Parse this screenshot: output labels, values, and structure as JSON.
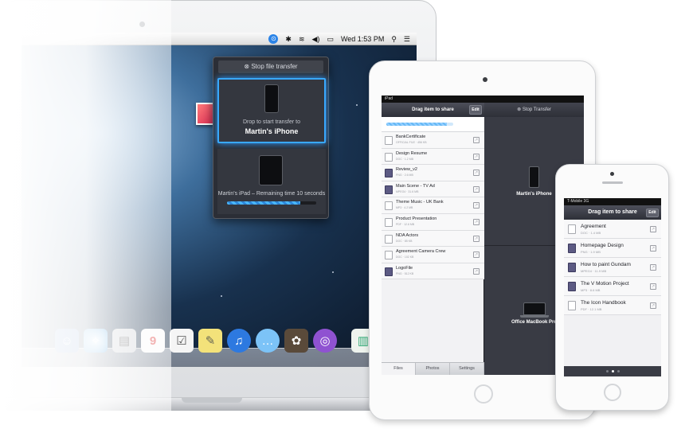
{
  "mac": {
    "menubar": {
      "clock": "Wed 1:53 PM",
      "icons": [
        "app-icon",
        "bluetooth-icon",
        "wifi-icon",
        "volume-icon",
        "battery-icon",
        "spotlight-icon",
        "notification-center-icon"
      ]
    },
    "popover": {
      "stop_label": "Stop file transfer",
      "drop_hint": "Drop to start transfer to",
      "target_device": "Martin's iPhone",
      "secondary_status": "Martin's iPad – Remaining time 10 seconds",
      "progress": 0.82
    },
    "dock": {
      "icons": [
        "finder-icon",
        "safari-icon",
        "preview-icon",
        "calendar-icon",
        "reminders-icon",
        "notes-icon",
        "app-store-icon",
        "messages-icon",
        "iphoto-icon",
        "instashare-icon",
        "file-icon",
        "trash-icon"
      ],
      "calendar_day": "9"
    }
  },
  "ipad": {
    "status": "iPad",
    "header": "Drag item to share",
    "edit_label": "Edit",
    "stop_label": "Stop Transfer",
    "progress": 0.9,
    "files": [
      {
        "name": "BankCertificate",
        "sub": "OFFICIAL FILE · 456 KB"
      },
      {
        "name": "Design Resume",
        "sub": "DOC · 1.2 MB"
      },
      {
        "name": "Review_v2",
        "sub": "PNG · 2.6 MB"
      },
      {
        "name": "Main Scene - TV Ad",
        "sub": "MPEG4 · 31.6 MB"
      },
      {
        "name": "Theme Music - UK Bank",
        "sub": "MP3 · 4.2 MB"
      },
      {
        "name": "Product Presentation",
        "sub": "PDF · 12.6 MB"
      },
      {
        "name": "NDA Actors",
        "sub": "DOC · 85 KB"
      },
      {
        "name": "Agreement Camera Crew",
        "sub": "DOC · 102 KB"
      },
      {
        "name": "LogoFile",
        "sub": "PNG · 512 KB"
      }
    ],
    "tabs": [
      "Files",
      "Photos",
      "Settings"
    ],
    "zones": [
      "Martin's iPhone",
      "Office MacBook Pro"
    ]
  },
  "iphone": {
    "status": "T-Mobile 3G",
    "header": "Drag item to share",
    "edit_label": "Edit",
    "files": [
      {
        "name": "Agreement",
        "sub": "DOC · 1.4 MB"
      },
      {
        "name": "Homepage Design",
        "sub": "PNG · 1.9 MB"
      },
      {
        "name": "How to paint Gundam",
        "sub": "MPEG4 · 11.9 MB"
      },
      {
        "name": "The V Motion Project",
        "sub": "MP3 · 8.6 MB"
      },
      {
        "name": "The Icon Handbook",
        "sub": "PDF · 12.1 MB"
      }
    ]
  }
}
